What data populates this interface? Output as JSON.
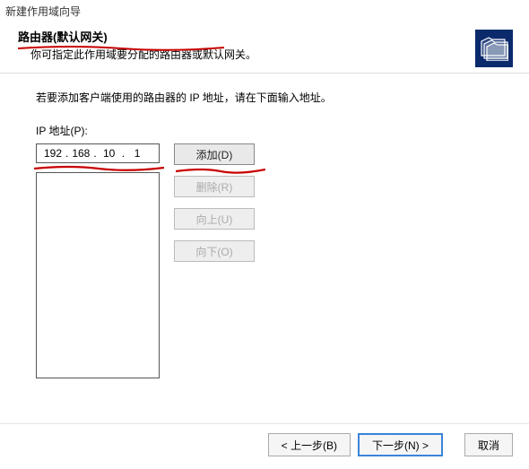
{
  "window": {
    "title": "新建作用域向导"
  },
  "header": {
    "title": "路由器(默认网关)",
    "description": "你可指定此作用域要分配的路由器或默认网关。"
  },
  "instruction": "若要添加客户端使用的路由器的 IP 地址，请在下面输入地址。",
  "ip": {
    "label": "IP 地址(P):",
    "octets": [
      "192",
      "168",
      "10",
      "1"
    ]
  },
  "buttons": {
    "add": "添加(D)",
    "remove": "删除(R)",
    "up": "向上(U)",
    "down": "向下(O)"
  },
  "footer": {
    "back": "< 上一步(B)",
    "next": "下一步(N) >",
    "cancel": "取消"
  }
}
